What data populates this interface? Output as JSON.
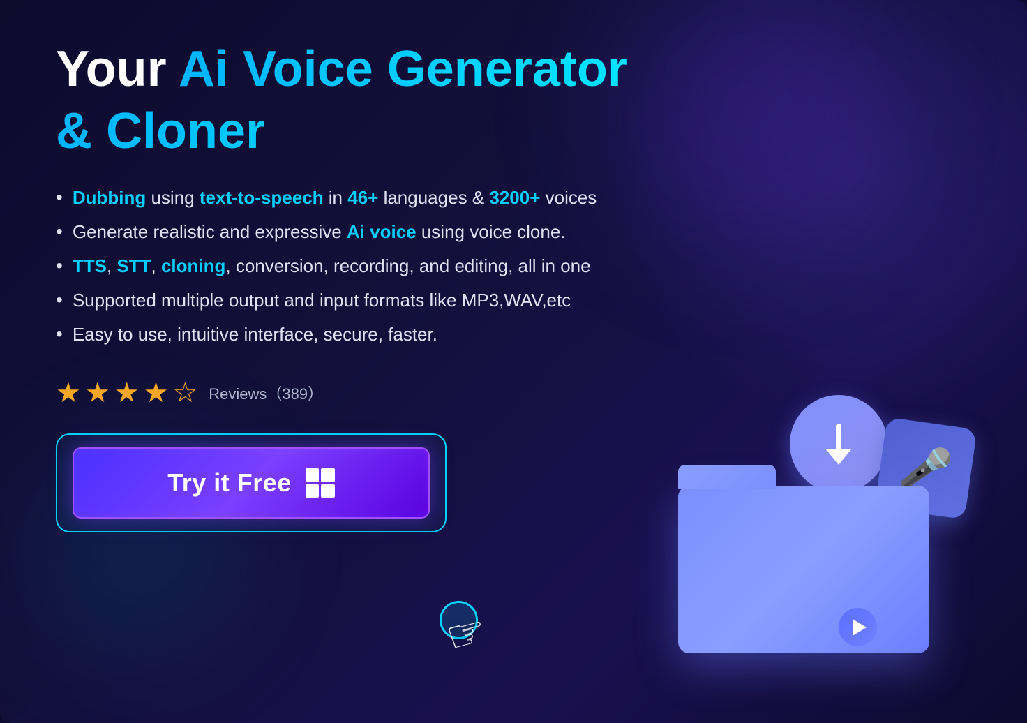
{
  "page": {
    "background_color": "#0d0a2e"
  },
  "hero": {
    "title_prefix": "Your ",
    "title_accent": "Ai Voice Generator",
    "title_line2": "& Cloner",
    "features": [
      {
        "id": 1,
        "parts": [
          {
            "text": "Dubbing",
            "type": "highlight"
          },
          {
            "text": " using ",
            "type": "normal"
          },
          {
            "text": "text-to-speech",
            "type": "highlight"
          },
          {
            "text": " in ",
            "type": "normal"
          },
          {
            "text": "46+",
            "type": "highlight"
          },
          {
            "text": " languages & ",
            "type": "normal"
          },
          {
            "text": "3200+",
            "type": "highlight"
          },
          {
            "text": " voices",
            "type": "normal"
          }
        ],
        "full_text": "Dubbing using text-to-speech in 46+ languages & 3200+ voices"
      },
      {
        "id": 2,
        "parts": [
          {
            "text": "Generate realistic and expressive ",
            "type": "normal"
          },
          {
            "text": "Ai voice",
            "type": "highlight"
          },
          {
            "text": " using voice clone.",
            "type": "normal"
          }
        ],
        "full_text": "Generate realistic and expressive Ai voice using voice clone."
      },
      {
        "id": 3,
        "parts": [
          {
            "text": "TTS",
            "type": "highlight"
          },
          {
            "text": ", ",
            "type": "normal"
          },
          {
            "text": "STT",
            "type": "highlight"
          },
          {
            "text": ", ",
            "type": "normal"
          },
          {
            "text": "cloning",
            "type": "highlight"
          },
          {
            "text": ", conversion, recording, and editing, all in one",
            "type": "normal"
          }
        ],
        "full_text": "TTS, STT, cloning, conversion, recording, and editing, all in one"
      },
      {
        "id": 4,
        "parts": [
          {
            "text": "Supported multiple output and input formats like MP3,WAV,etc",
            "type": "normal"
          }
        ],
        "full_text": "Supported multiple output and input formats like MP3,WAV,etc"
      },
      {
        "id": 5,
        "parts": [
          {
            "text": "Easy to use, intuitive interface, secure, faster.",
            "type": "normal"
          }
        ],
        "full_text": "Easy to use, intuitive interface, secure, faster."
      }
    ],
    "reviews": {
      "stars": 4.5,
      "label": "Reviews",
      "count": "389",
      "full_text": "Reviews（389）"
    },
    "cta_button": {
      "label": "Try it Free",
      "icon": "windows-icon",
      "icon_label": "⊞"
    }
  },
  "colors": {
    "background": "#0d0a2e",
    "accent_blue": "#00d4ff",
    "accent_purple": "#7b3fff",
    "star_color": "#f5a623",
    "button_gradient_start": "#4a2fff",
    "button_gradient_end": "#5a00e0",
    "text_primary": "#ffffff",
    "text_secondary": "#e0e0f0",
    "text_muted": "#b0b8d0",
    "highlight_color": "#00cfff"
  }
}
